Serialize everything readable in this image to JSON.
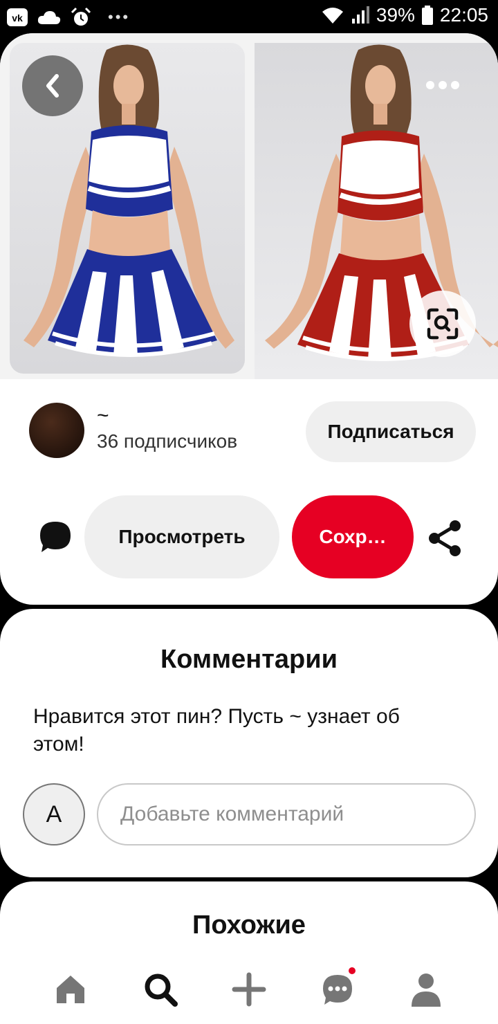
{
  "status_bar": {
    "battery": "39%",
    "time": "22:05",
    "icons": [
      "vk-icon",
      "cloud-icon",
      "alarm-icon",
      "wifi-icon",
      "signal-icon",
      "battery-icon"
    ]
  },
  "pin": {
    "images": [
      {
        "description_icon": "cheerleader-photo-blue"
      },
      {
        "description_icon": "cheerleader-photo-red"
      }
    ]
  },
  "creator": {
    "name": "~",
    "followers": "36 подписчиков",
    "follow_label": "Подписаться"
  },
  "actions": {
    "view_label": "Просмотреть",
    "save_label": "Сохр…"
  },
  "comments": {
    "title": "Комментарии",
    "prompt": "Нравится этот пин? Пусть ~ узнает об этом!",
    "user_initial": "A",
    "input_placeholder": "Добавьте комментарий"
  },
  "similar": {
    "title": "Похожие"
  },
  "nav": {
    "items": [
      "home-icon",
      "search-icon",
      "add-icon",
      "messages-icon",
      "profile-icon"
    ],
    "active": "search-icon"
  },
  "colors": {
    "accent": "#e60023",
    "pill_bg": "#efefef",
    "nav_inactive": "#767676",
    "nav_active": "#111111",
    "uniform_blue": "#1f2f9a",
    "uniform_red": "#b01f17"
  }
}
